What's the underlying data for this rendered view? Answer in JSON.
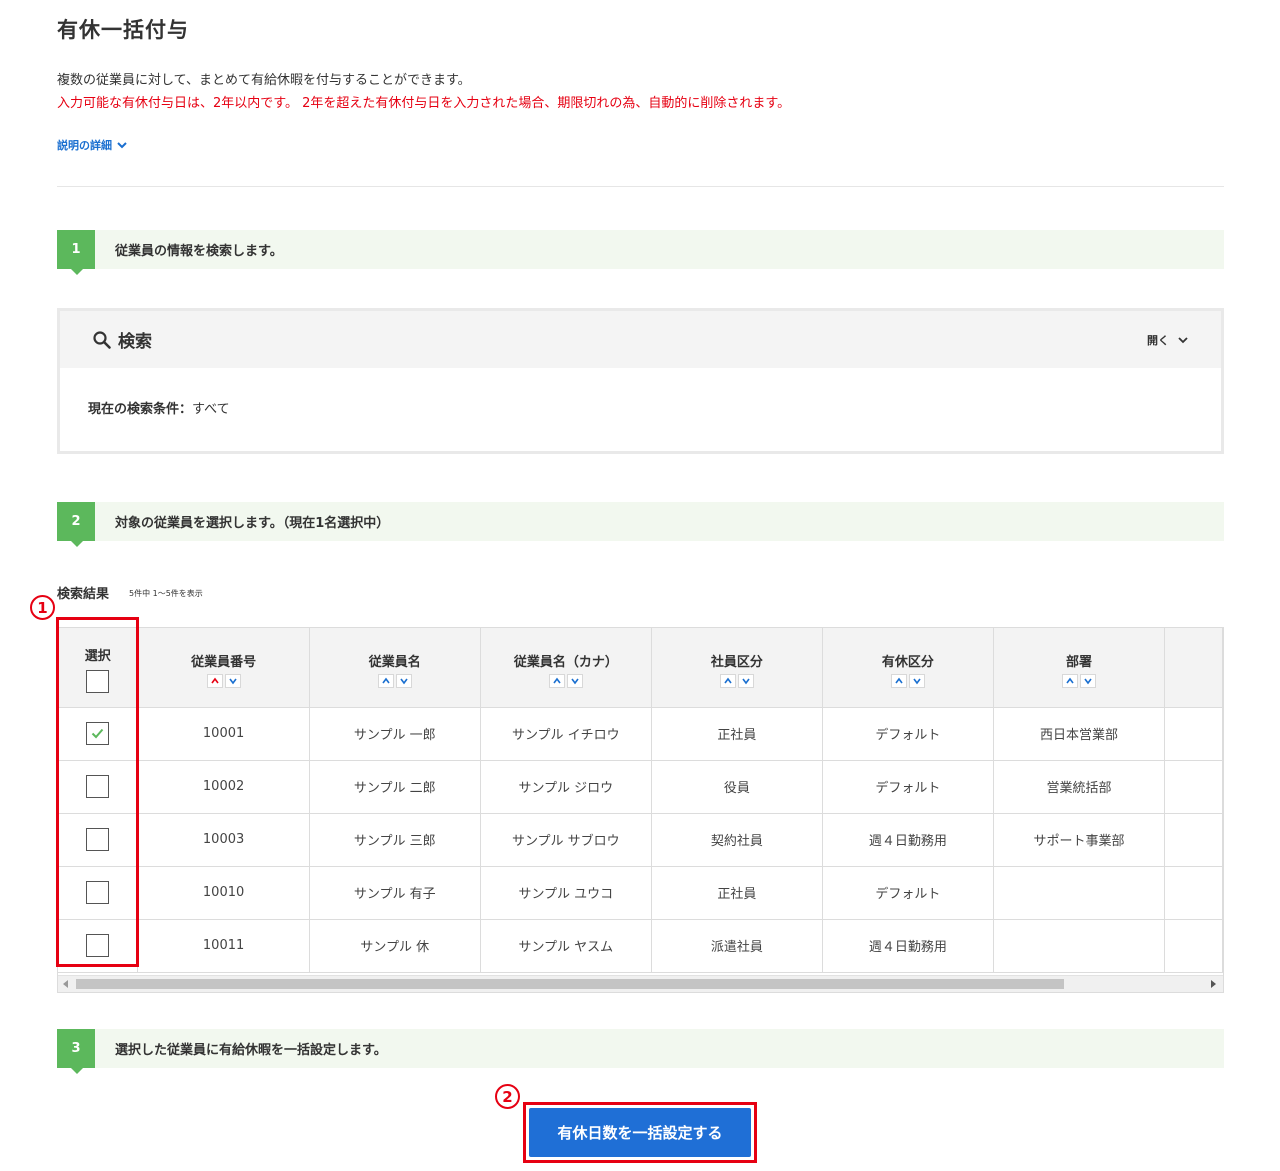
{
  "page": {
    "title": "有休一括付与",
    "description": "複数の従業員に対して、まとめて有給休暇を付与することができます。",
    "warning": "入力可能な有休付与日は、2年以内です。 2年を超えた有休付与日を入力された場合、期限切れの為、自動的に削除されます。",
    "details_link": "説明の詳細"
  },
  "steps": [
    {
      "num": "1",
      "text": "従業員の情報を検索します。"
    },
    {
      "num": "2",
      "text": "対象の従業員を選択します。（現在1名選択中）"
    },
    {
      "num": "3",
      "text": "選択した従業員に有給休暇を一括設定します。"
    }
  ],
  "search": {
    "title": "検索",
    "toggle_label": "開く",
    "condition_label": "現在の検索条件：",
    "condition_value": "すべて"
  },
  "results": {
    "label": "検索結果",
    "count_text": "5件中 1～5件を表示",
    "columns": [
      "選択",
      "従業員番号",
      "従業員名",
      "従業員名（カナ）",
      "社員区分",
      "有休区分",
      "部署"
    ],
    "rows": [
      {
        "checked": true,
        "cells": [
          "10001",
          "サンプル 一郎",
          "サンプル イチロウ",
          "正社員",
          "デフォルト",
          "西日本営業部"
        ]
      },
      {
        "checked": false,
        "cells": [
          "10002",
          "サンプル 二郎",
          "サンプル ジロウ",
          "役員",
          "デフォルト",
          "営業統括部"
        ]
      },
      {
        "checked": false,
        "cells": [
          "10003",
          "サンプル 三郎",
          "サンプル サブロウ",
          "契約社員",
          "週４日勤務用",
          "サポート事業部"
        ]
      },
      {
        "checked": false,
        "cells": [
          "10010",
          "サンプル 有子",
          "サンプル ユウコ",
          "正社員",
          "デフォルト",
          ""
        ]
      },
      {
        "checked": false,
        "cells": [
          "10011",
          "サンプル 休",
          "サンプル ヤスム",
          "派遣社員",
          "週４日勤務用",
          ""
        ]
      }
    ]
  },
  "annotations": {
    "one": "1",
    "two": "2"
  },
  "actions": {
    "bulk_button": "有休日数を一括設定する"
  },
  "colors": {
    "accent": "#5cb85c",
    "button": "#1f6fd6",
    "warning": "#e60012",
    "active_sort": "#e60012"
  }
}
